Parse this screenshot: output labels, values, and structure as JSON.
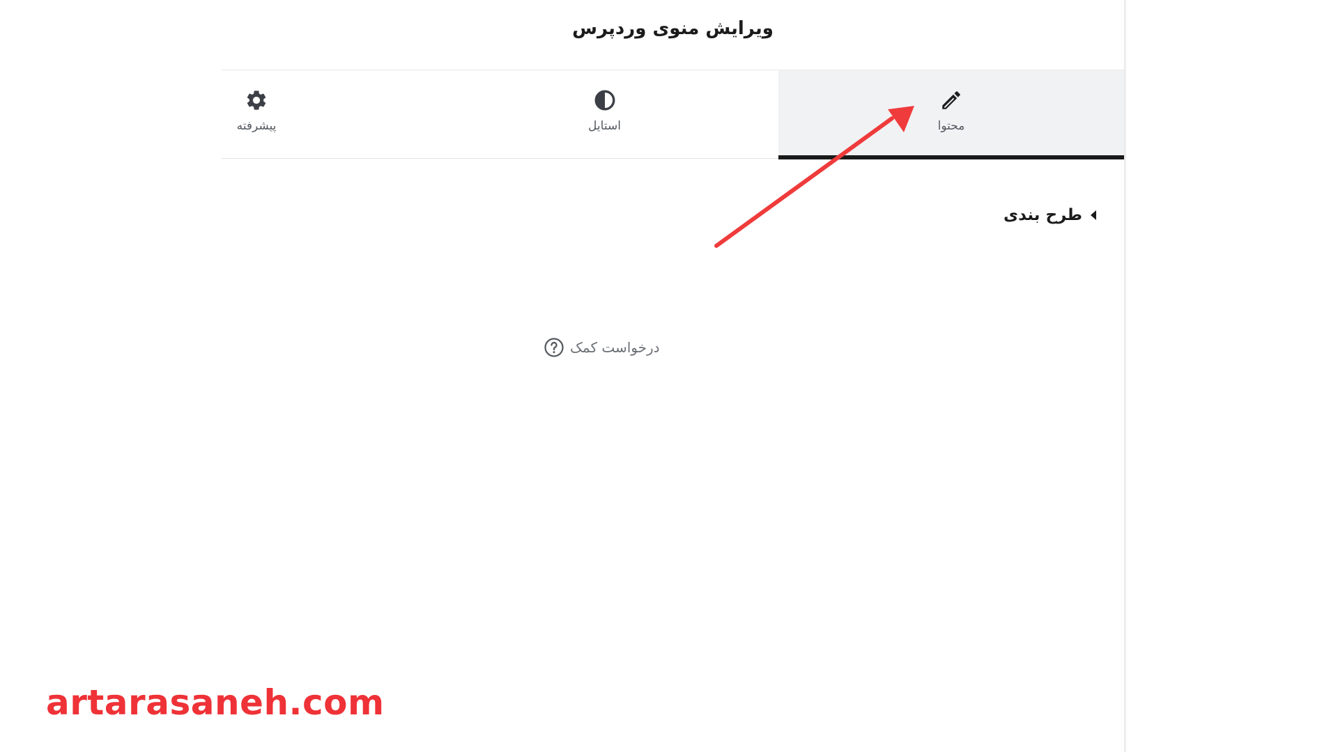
{
  "header": {
    "title": "ویرایش منوی وردپرس"
  },
  "tabs": [
    {
      "label": "محتوا",
      "icon": "pencil-icon",
      "active": true
    },
    {
      "label": "استایل",
      "icon": "half-circle-icon",
      "active": false
    },
    {
      "label": "پیشرفته",
      "icon": "gear-icon",
      "active": false
    }
  ],
  "section": {
    "label": "طرح بندی",
    "icon": "caret-left-icon"
  },
  "help": {
    "label": "درخواست کمک",
    "icon": "question-circle-icon"
  },
  "watermark": {
    "text": "artarasaneh.com"
  },
  "colors": {
    "active_tab_bg": "#f1f2f4",
    "active_tab_underline": "#1a1a1a",
    "annotation_arrow": "#ef3b3b",
    "watermark": "#ee3237"
  }
}
